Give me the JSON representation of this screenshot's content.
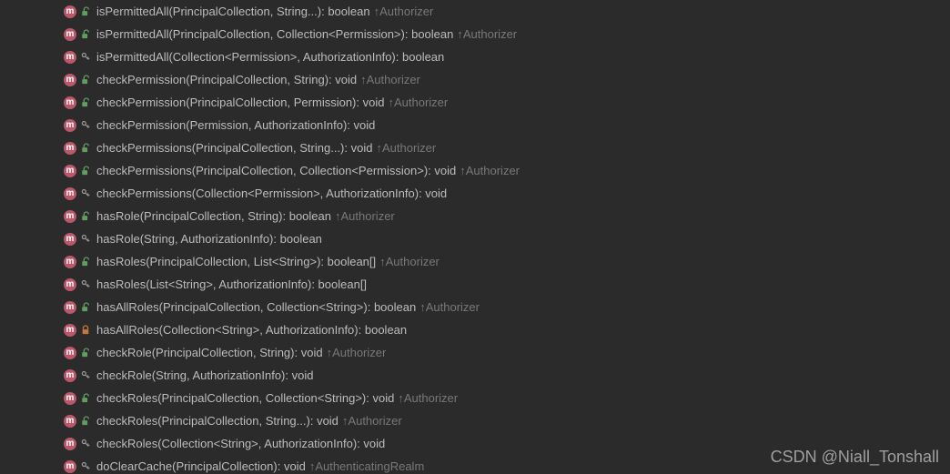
{
  "icons": {
    "method_letter": "m",
    "origin_arrow": "↑"
  },
  "watermark": "CSDN @Niall_Tonshall",
  "rows": [
    {
      "mod": "public",
      "name": "isPermittedAll",
      "params": "(PrincipalCollection, String...)",
      "ret": "boolean",
      "origin": "Authorizer"
    },
    {
      "mod": "public",
      "name": "isPermittedAll",
      "params": "(PrincipalCollection, Collection<Permission>)",
      "ret": "boolean",
      "origin": "Authorizer"
    },
    {
      "mod": "protected",
      "name": "isPermittedAll",
      "params": "(Collection<Permission>, AuthorizationInfo)",
      "ret": "boolean",
      "origin": ""
    },
    {
      "mod": "public",
      "name": "checkPermission",
      "params": "(PrincipalCollection, String)",
      "ret": "void",
      "origin": "Authorizer"
    },
    {
      "mod": "public",
      "name": "checkPermission",
      "params": "(PrincipalCollection, Permission)",
      "ret": "void",
      "origin": "Authorizer"
    },
    {
      "mod": "protected",
      "name": "checkPermission",
      "params": "(Permission, AuthorizationInfo)",
      "ret": "void",
      "origin": ""
    },
    {
      "mod": "public",
      "name": "checkPermissions",
      "params": "(PrincipalCollection, String...)",
      "ret": "void",
      "origin": "Authorizer"
    },
    {
      "mod": "public",
      "name": "checkPermissions",
      "params": "(PrincipalCollection, Collection<Permission>)",
      "ret": "void",
      "origin": "Authorizer"
    },
    {
      "mod": "protected",
      "name": "checkPermissions",
      "params": "(Collection<Permission>, AuthorizationInfo)",
      "ret": "void",
      "origin": ""
    },
    {
      "mod": "public",
      "name": "hasRole",
      "params": "(PrincipalCollection, String)",
      "ret": "boolean",
      "origin": "Authorizer"
    },
    {
      "mod": "protected",
      "name": "hasRole",
      "params": "(String, AuthorizationInfo)",
      "ret": "boolean",
      "origin": ""
    },
    {
      "mod": "public",
      "name": "hasRoles",
      "params": "(PrincipalCollection, List<String>)",
      "ret": "boolean[]",
      "origin": "Authorizer"
    },
    {
      "mod": "protected",
      "name": "hasRoles",
      "params": "(List<String>, AuthorizationInfo)",
      "ret": "boolean[]",
      "origin": ""
    },
    {
      "mod": "public",
      "name": "hasAllRoles",
      "params": "(PrincipalCollection, Collection<String>)",
      "ret": "boolean",
      "origin": "Authorizer"
    },
    {
      "mod": "private",
      "name": "hasAllRoles",
      "params": "(Collection<String>, AuthorizationInfo)",
      "ret": "boolean",
      "origin": ""
    },
    {
      "mod": "public",
      "name": "checkRole",
      "params": "(PrincipalCollection, String)",
      "ret": "void",
      "origin": "Authorizer"
    },
    {
      "mod": "protected",
      "name": "checkRole",
      "params": "(String, AuthorizationInfo)",
      "ret": "void",
      "origin": ""
    },
    {
      "mod": "public",
      "name": "checkRoles",
      "params": "(PrincipalCollection, Collection<String>)",
      "ret": "void",
      "origin": "Authorizer"
    },
    {
      "mod": "public",
      "name": "checkRoles",
      "params": "(PrincipalCollection, String...)",
      "ret": "void",
      "origin": "Authorizer"
    },
    {
      "mod": "protected",
      "name": "checkRoles",
      "params": "(Collection<String>, AuthorizationInfo)",
      "ret": "void",
      "origin": ""
    },
    {
      "mod": "protected",
      "name": "doClearCache",
      "params": "(PrincipalCollection)",
      "ret": "void",
      "origin": "AuthenticatingRealm"
    }
  ]
}
